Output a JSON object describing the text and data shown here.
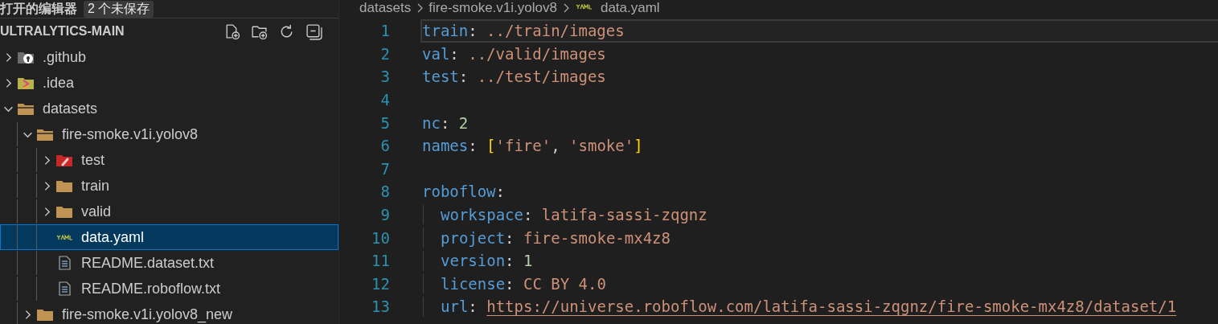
{
  "open_editors": {
    "title": "打开的编辑器",
    "badge": "2 个未保存"
  },
  "explorer": {
    "title": "ULTRALYTICS-MAIN",
    "tree": [
      {
        "name": ".github",
        "kind": "github-folder",
        "expanded": false,
        "selected": false
      },
      {
        "name": ".idea",
        "kind": "idea-folder",
        "expanded": false,
        "selected": false
      },
      {
        "name": "datasets",
        "kind": "folder",
        "expanded": true,
        "selected": false,
        "children": [
          {
            "name": "fire-smoke.v1i.yolov8",
            "kind": "folder",
            "expanded": true,
            "selected": false,
            "children": [
              {
                "name": "test",
                "kind": "test-folder",
                "expanded": false,
                "selected": false
              },
              {
                "name": "train",
                "kind": "folder",
                "expanded": false,
                "selected": false
              },
              {
                "name": "valid",
                "kind": "folder",
                "expanded": false,
                "selected": false
              },
              {
                "name": "data.yaml",
                "kind": "yaml",
                "selected": true
              },
              {
                "name": "README.dataset.txt",
                "kind": "text",
                "selected": false
              },
              {
                "name": "README.roboflow.txt",
                "kind": "text",
                "selected": false
              }
            ]
          },
          {
            "name": "fire-smoke.v1i.yolov8_new",
            "kind": "folder",
            "expanded": false,
            "selected": false
          }
        ]
      }
    ]
  },
  "breadcrumbs": [
    {
      "text": "datasets",
      "kind": "folder"
    },
    {
      "text": "fire-smoke.v1i.yolov8",
      "kind": "folder"
    },
    {
      "text": "data.yaml",
      "kind": "yaml"
    }
  ],
  "editor": {
    "lines": [
      {
        "number": "1",
        "current": true,
        "indent": false,
        "tokens": [
          {
            "t": "train",
            "kind": "key"
          },
          {
            "t": ": ",
            "kind": "punct"
          },
          {
            "t": "../train/images",
            "kind": "string"
          }
        ]
      },
      {
        "number": "2",
        "current": false,
        "indent": false,
        "tokens": [
          {
            "t": "val",
            "kind": "key"
          },
          {
            "t": ": ",
            "kind": "punct"
          },
          {
            "t": "../valid/images",
            "kind": "string"
          }
        ]
      },
      {
        "number": "3",
        "current": false,
        "indent": false,
        "tokens": [
          {
            "t": "test",
            "kind": "key"
          },
          {
            "t": ": ",
            "kind": "punct"
          },
          {
            "t": "../test/images",
            "kind": "string"
          }
        ]
      },
      {
        "number": "4",
        "current": false,
        "indent": false
      },
      {
        "number": "5",
        "current": false,
        "indent": false,
        "tokens": [
          {
            "t": "nc",
            "kind": "key"
          },
          {
            "t": ": ",
            "kind": "punct"
          },
          {
            "t": "2",
            "kind": "number"
          }
        ]
      },
      {
        "number": "6",
        "current": false,
        "indent": false,
        "tokens": [
          {
            "t": "names",
            "kind": "key"
          },
          {
            "t": ": ",
            "kind": "punct"
          },
          {
            "t": "[",
            "kind": "bracket"
          },
          {
            "t": "'fire'",
            "kind": "string"
          },
          {
            "t": ", ",
            "kind": "punct"
          },
          {
            "t": "'smoke'",
            "kind": "string"
          },
          {
            "t": "]",
            "kind": "bracket"
          }
        ]
      },
      {
        "number": "7",
        "current": false,
        "indent": false
      },
      {
        "number": "8",
        "current": false,
        "indent": false,
        "tokens": [
          {
            "t": "roboflow",
            "kind": "key"
          },
          {
            "t": ":",
            "kind": "punct"
          }
        ]
      },
      {
        "number": "9",
        "current": false,
        "indent": true,
        "tokens": [
          {
            "t": "workspace",
            "kind": "key"
          },
          {
            "t": ": ",
            "kind": "punct"
          },
          {
            "t": "latifa-sassi-zqgnz",
            "kind": "string"
          }
        ]
      },
      {
        "number": "10",
        "current": false,
        "indent": true,
        "tokens": [
          {
            "t": "project",
            "kind": "key"
          },
          {
            "t": ": ",
            "kind": "punct"
          },
          {
            "t": "fire-smoke-mx4z8",
            "kind": "string"
          }
        ]
      },
      {
        "number": "11",
        "current": false,
        "indent": true,
        "tokens": [
          {
            "t": "version",
            "kind": "key"
          },
          {
            "t": ": ",
            "kind": "punct"
          },
          {
            "t": "1",
            "kind": "number"
          }
        ]
      },
      {
        "number": "12",
        "current": false,
        "indent": true,
        "tokens": [
          {
            "t": "license",
            "kind": "key"
          },
          {
            "t": ": ",
            "kind": "punct"
          },
          {
            "t": "CC BY 4.0",
            "kind": "string"
          }
        ]
      },
      {
        "number": "13",
        "current": false,
        "indent": true,
        "tokens": [
          {
            "t": "url",
            "kind": "key"
          },
          {
            "t": ": ",
            "kind": "punct"
          },
          {
            "t": "https://universe.roboflow.com/latifa-sassi-zqgnz/fire-smoke-mx4z8/dataset/1",
            "kind": "link"
          }
        ]
      }
    ]
  }
}
